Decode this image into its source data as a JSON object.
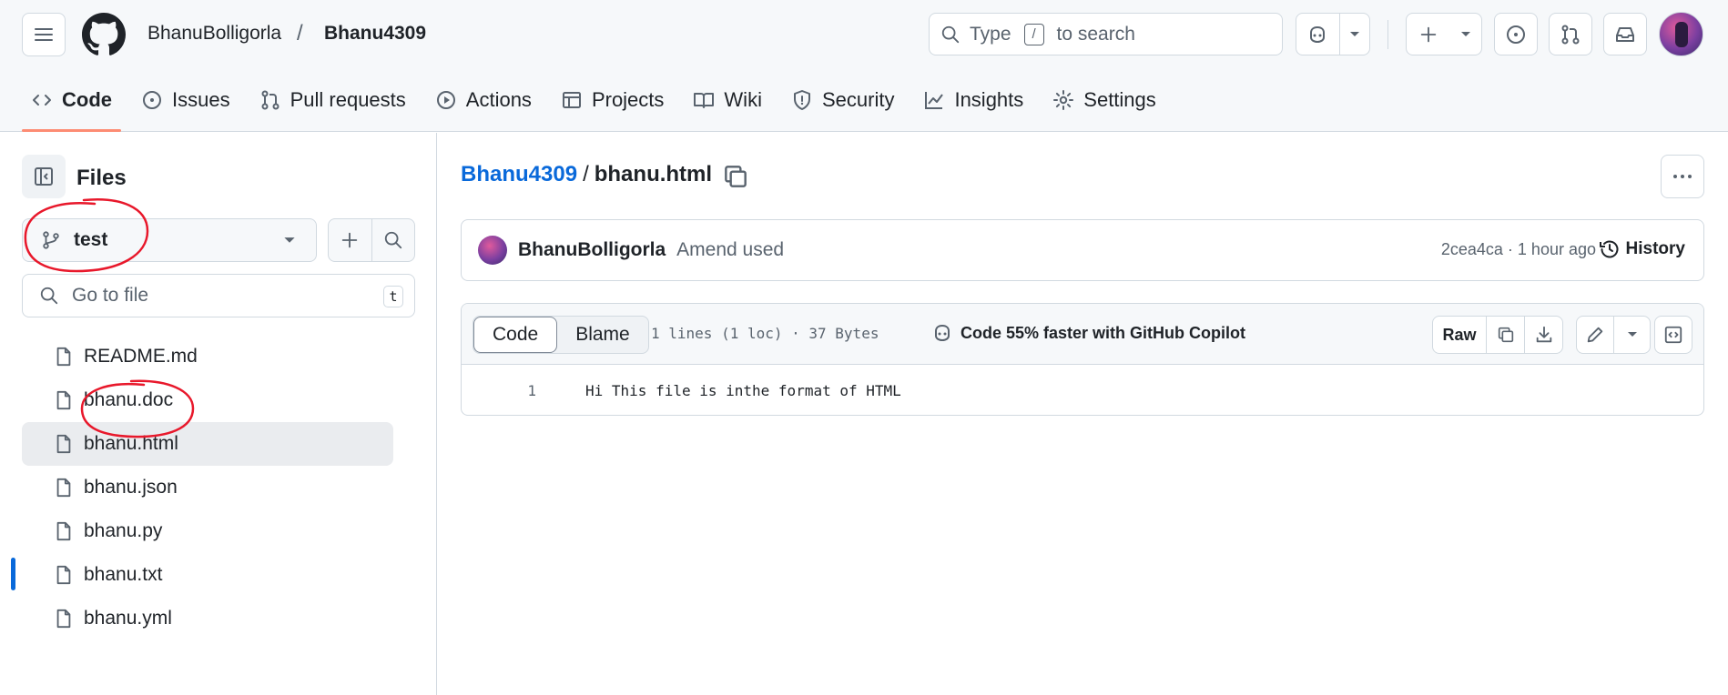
{
  "header": {
    "owner": "BhanuBolligorla",
    "separator": "/",
    "repo": "Bhanu4309",
    "search": {
      "prefix": "Type",
      "key": "/",
      "suffix": "to search"
    }
  },
  "nav": {
    "tabs": [
      {
        "label": "Code",
        "icon": "code-icon",
        "active": true
      },
      {
        "label": "Issues",
        "icon": "issue-icon"
      },
      {
        "label": "Pull requests",
        "icon": "pull-request-icon"
      },
      {
        "label": "Actions",
        "icon": "play-icon"
      },
      {
        "label": "Projects",
        "icon": "table-icon"
      },
      {
        "label": "Wiki",
        "icon": "book-icon"
      },
      {
        "label": "Security",
        "icon": "shield-icon"
      },
      {
        "label": "Insights",
        "icon": "graph-icon"
      },
      {
        "label": "Settings",
        "icon": "gear-icon"
      }
    ]
  },
  "sidebar": {
    "title": "Files",
    "branch": "test",
    "goto_placeholder": "Go to file",
    "goto_key": "t",
    "files": [
      {
        "name": "README.md"
      },
      {
        "name": "bhanu.doc"
      },
      {
        "name": "bhanu.html",
        "active": true
      },
      {
        "name": "bhanu.json"
      },
      {
        "name": "bhanu.py"
      },
      {
        "name": "bhanu.txt"
      },
      {
        "name": "bhanu.yml"
      }
    ]
  },
  "main": {
    "path_repo": "Bhanu4309",
    "path_sep": "/",
    "path_file": "bhanu.html",
    "commit": {
      "author": "BhanuBolligorla",
      "message": "Amend used",
      "meta": "2cea4ca · 1 hour ago",
      "history_label": "History"
    },
    "file": {
      "view_code": "Code",
      "view_blame": "Blame",
      "info": "1 lines (1 loc) · 37 Bytes",
      "copilot": "Code 55% faster with GitHub Copilot",
      "raw_label": "Raw",
      "lines": [
        {
          "num": "1",
          "text": "Hi This file is inthe format of HTML"
        }
      ]
    }
  },
  "colors": {
    "link": "#0969da",
    "tab_underline": "#fd8c73",
    "annotation": "#e8182b",
    "border": "#d1d9e0"
  }
}
